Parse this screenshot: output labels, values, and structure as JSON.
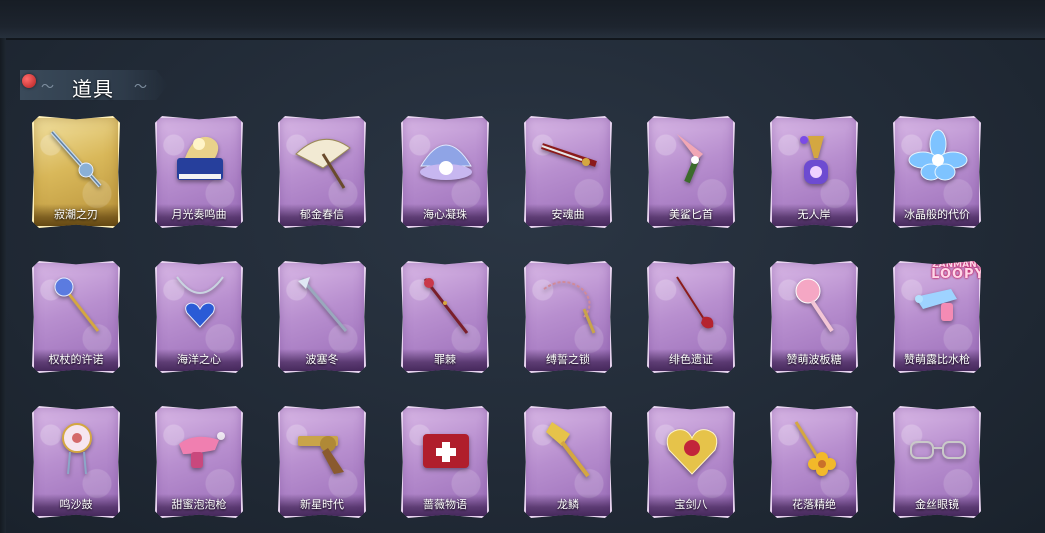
{
  "section": {
    "title": "道具"
  },
  "items": [
    {
      "name": "寂潮之刃",
      "icon": "blade-icon",
      "rarity": "gold"
    },
    {
      "name": "月光奏鸣曲",
      "icon": "piano-icon",
      "rarity": "purple"
    },
    {
      "name": "郁金春信",
      "icon": "umbrella-icon",
      "rarity": "purple"
    },
    {
      "name": "海心凝珠",
      "icon": "shell-pearl-icon",
      "rarity": "purple"
    },
    {
      "name": "安魂曲",
      "icon": "sword-icon",
      "rarity": "purple"
    },
    {
      "name": "美鲨匕首",
      "icon": "shark-dagger-icon",
      "rarity": "purple"
    },
    {
      "name": "无人岸",
      "icon": "perfume-bottle-icon",
      "rarity": "purple"
    },
    {
      "name": "冰晶般的代价",
      "icon": "ice-flower-icon",
      "rarity": "purple"
    },
    {
      "name": "权杖的许诺",
      "icon": "scepter-icon",
      "rarity": "purple"
    },
    {
      "name": "海洋之心",
      "icon": "heart-necklace-icon",
      "rarity": "purple"
    },
    {
      "name": "波塞冬",
      "icon": "trident-icon",
      "rarity": "purple"
    },
    {
      "name": "罪棘",
      "icon": "thorn-staff-icon",
      "rarity": "purple"
    },
    {
      "name": "缚誓之锁",
      "icon": "chain-whip-icon",
      "rarity": "purple"
    },
    {
      "name": "绯色遗证",
      "icon": "rapier-icon",
      "rarity": "purple"
    },
    {
      "name": "赞萌波板糖",
      "icon": "lollipop-icon",
      "rarity": "purple"
    },
    {
      "name": "赞萌露比水枪",
      "icon": "water-gun-icon",
      "rarity": "purple",
      "badge": "ZANMANG LOOPY"
    },
    {
      "name": "鸣沙鼓",
      "icon": "dreamcatcher-icon",
      "rarity": "purple"
    },
    {
      "name": "甜蜜泡泡枪",
      "icon": "bubble-gun-icon",
      "rarity": "purple"
    },
    {
      "name": "新星时代",
      "icon": "revolver-icon",
      "rarity": "purple"
    },
    {
      "name": "蔷薇物语",
      "icon": "medkit-icon",
      "rarity": "purple"
    },
    {
      "name": "龙鳞",
      "icon": "golden-spade-icon",
      "rarity": "purple"
    },
    {
      "name": "宝剑八",
      "icon": "heart-mirror-icon",
      "rarity": "purple"
    },
    {
      "name": "花落精绝",
      "icon": "flower-staff-icon",
      "rarity": "purple"
    },
    {
      "name": "金丝眼镜",
      "icon": "glasses-icon",
      "rarity": "purple"
    }
  ],
  "badge": {
    "line1": "ZANMANG",
    "line2": "LOOPY"
  },
  "colors": {
    "gold_card": "#d9b85a",
    "purple_card": "#b88fcf",
    "background": "#212a36"
  }
}
